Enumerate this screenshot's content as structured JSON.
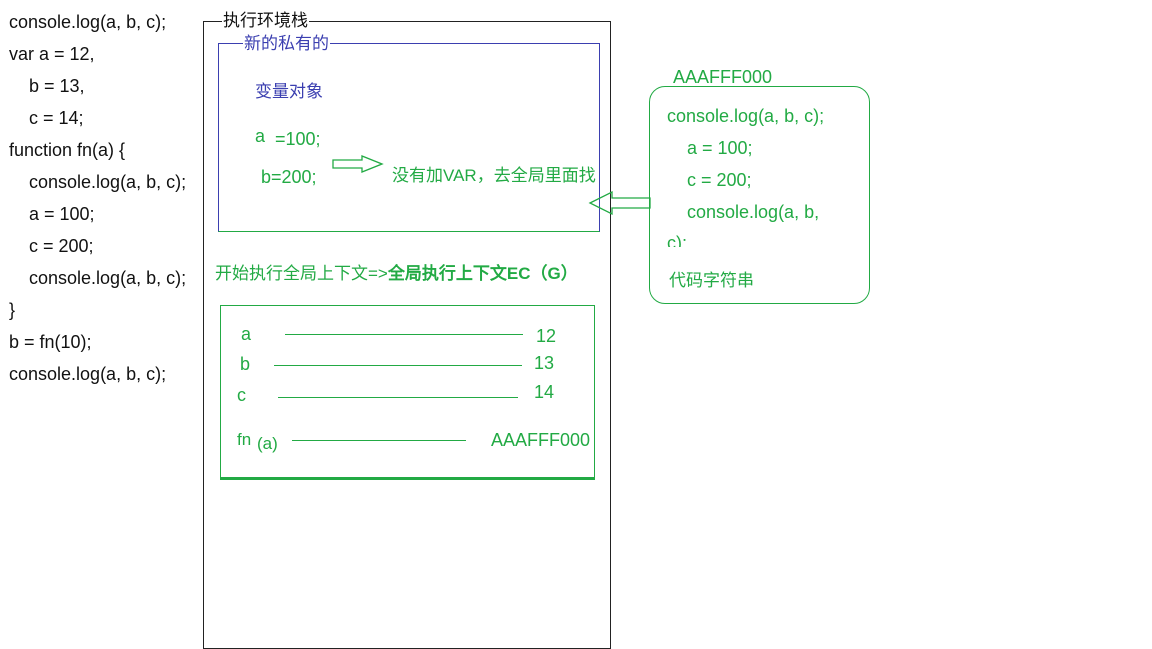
{
  "code_lines": [
    "console.log(a, b, c);",
    "var a = 12,",
    "b = 13,",
    "c = 14;",
    "function fn(a) {",
    "console.log(a, b, c);",
    "a = 100;",
    "c = 200;",
    "console.log(a, b, c);",
    "}",
    "b = fn(10);",
    "console.log(a, b, c);"
  ],
  "stack": {
    "title": "执行环境栈",
    "private_title": "新的私有的",
    "var_object_label": "变量对象",
    "var_a": "a",
    "var_a_value": "=100;",
    "var_b": "b=200;",
    "arrow_note": "没有加VAR，去全局里面找"
  },
  "global": {
    "note_plain": "开始执行全局上下文=>",
    "note_bold": "全局执行上下文EC（G）",
    "vars": [
      {
        "name": "a",
        "value": "12"
      },
      {
        "name": "b",
        "value": "13"
      },
      {
        "name": "c",
        "value": "14"
      },
      {
        "name": "fn",
        "suffix": "(a)",
        "value": "AAAFFF000"
      }
    ]
  },
  "heap": {
    "address": "AAAFFF000",
    "lines": [
      "console.log(a, b, c);",
      "a = 100;",
      "c = 200;",
      "console.log(a, b,",
      "c);"
    ],
    "caption": "代码字符串"
  },
  "colors": {
    "green": "#22aa44",
    "blue": "#3b3fb0",
    "stack_border": "#222222"
  }
}
